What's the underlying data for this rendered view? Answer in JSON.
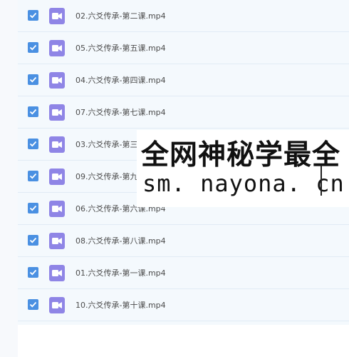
{
  "files": [
    {
      "name": "02.六爻传承-第二课.mp4",
      "checked": true
    },
    {
      "name": "05.六爻传承-第五课.mp4",
      "checked": true
    },
    {
      "name": "04.六爻传承-第四课.mp4",
      "checked": true
    },
    {
      "name": "07.六爻传承-第七课.mp4",
      "checked": true
    },
    {
      "name": "03.六爻传承-第三课.mp4",
      "checked": true
    },
    {
      "name": "09.六爻传承-第九课.mp4",
      "checked": true
    },
    {
      "name": "06.六爻传承-第六课.mp4",
      "checked": true
    },
    {
      "name": "08.六爻传承-第八课.mp4",
      "checked": true
    },
    {
      "name": "01.六爻传承-第一课.mp4",
      "checked": true
    },
    {
      "name": "10.六爻传承-第十课.mp4",
      "checked": true
    }
  ],
  "file_icon": "video-file-icon",
  "colors": {
    "checkbox": "#4a90e2",
    "file_icon": "#8f85e6",
    "row_background": "#f4f9fd"
  },
  "watermark": {
    "line1": "全网神秘学最全",
    "line2": "sm. nayona. cn"
  }
}
